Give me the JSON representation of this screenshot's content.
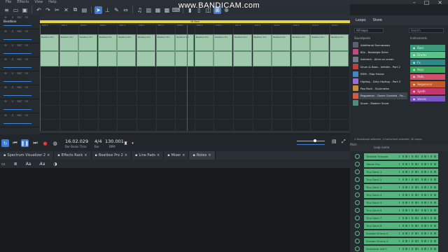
{
  "menubar": {
    "items": [
      "File",
      "Effects",
      "View",
      "Help"
    ]
  },
  "watermark": "www.BANDICAM.com",
  "arranger": {
    "ruler_title": "16 Bars",
    "ruler_ticks": [
      "001:1",
      "002:1",
      "003:1",
      "004:1",
      "005:1",
      "006:1",
      "007:1",
      "008:1",
      "009:1",
      "010:1",
      "011:1",
      "012:1",
      "013:1",
      "014:1",
      "015:1",
      "016:1"
    ],
    "clip_label": "Beatbox Pro"
  },
  "tracks": [
    {
      "name": "Beatbox",
      "btns": [
        "M",
        "S",
        "REC",
        "FX"
      ]
    },
    {
      "name": "",
      "btns": [
        "M",
        "S",
        "REC",
        "FX"
      ]
    },
    {
      "name": "",
      "btns": [
        "M",
        "S",
        "REC",
        "FX"
      ]
    },
    {
      "name": "",
      "btns": [
        "M",
        "S",
        "REC",
        "FX"
      ]
    },
    {
      "name": "",
      "btns": [
        "M",
        "S",
        "REC",
        "FX"
      ]
    },
    {
      "name": "",
      "btns": [
        "M",
        "S",
        "REC",
        "FX"
      ]
    },
    {
      "name": "",
      "btns": [
        "M",
        "S",
        "REC",
        "FX"
      ]
    },
    {
      "name": "",
      "btns": [
        "M",
        "S",
        "REC",
        "FX"
      ]
    }
  ],
  "transport": {
    "position": "16.02.029",
    "position_label": "Bar Beats Ticks",
    "signature": "4/4",
    "signature_label": "Bar",
    "bpm": "130.001",
    "bpm_label": "BPM"
  },
  "bottom_tabs": [
    "Spectrum Visualizer 2",
    "Effects Rack",
    "Beatbox Pro 2",
    "Line Pads",
    "Mixer",
    "Notes"
  ],
  "doc_toolbar": {
    "font_size": "Aa",
    "font_style": "Aa"
  },
  "right": {
    "tab_loops": "Loops",
    "tab_store": "Store",
    "select": "All loops",
    "search": "Search",
    "col_soundpools": "Soundpools",
    "col_instruments": "Instruments",
    "soundpools": [
      {
        "name": "Additional Soundpools",
        "color": "#58636d"
      },
      {
        "name": "80s - Nostalgia Drive",
        "color": "#c34a7d"
      },
      {
        "name": "Ambient - Alive on ocean",
        "color": "#6e7a87"
      },
      {
        "name": "Drum & Bass - Infinite - Part 2",
        "color": "#b7423e"
      },
      {
        "name": "EDM - Slap House",
        "color": "#3f88c4"
      },
      {
        "name": "HipHop - Dirty HipHop - Part 3",
        "color": "#9c6cd1"
      },
      {
        "name": "Pop Rock - Soulmates",
        "color": "#c88a3a"
      },
      {
        "name": "Reggaeton - Dame Candela - Pa...",
        "color": "#d65a4a"
      },
      {
        "name": "Score - Modern Score",
        "color": "#4d8c83"
      }
    ],
    "instruments": [
      {
        "name": "Bass",
        "color": "#3c9a7a"
      },
      {
        "name": "Drums",
        "color": "#5cc08a"
      },
      {
        "name": "Fx",
        "color": "#2d8a88"
      },
      {
        "name": "Keys",
        "color": "#3aa65a"
      },
      {
        "name": "Pads",
        "color": "#d14e6c"
      },
      {
        "name": "Sequencer",
        "color": "#c25a2c"
      },
      {
        "name": "Synth",
        "color": "#c2386e"
      },
      {
        "name": "Vocals",
        "color": "#7b55c6"
      }
    ],
    "status": "1 Soundpool selected, 1 Instrument selected, 40 Loops.",
    "pitch_label": "Pitch",
    "loop_name_header": "Loop name",
    "loops": [
      "Timbale Triangle",
      "Tabaki Pan",
      "Tiny Deck 1",
      "Tiny Deck 2",
      "Tiny Deck 3",
      "Tiny Deck 4",
      "Tiny Deck 5",
      "Tiny Deck 6",
      "Tiny Deck 7",
      "Tiny Deck 8",
      "Solsdar Drums 3",
      "Solsdar Drums 4",
      "Serenthar loft 5"
    ]
  }
}
